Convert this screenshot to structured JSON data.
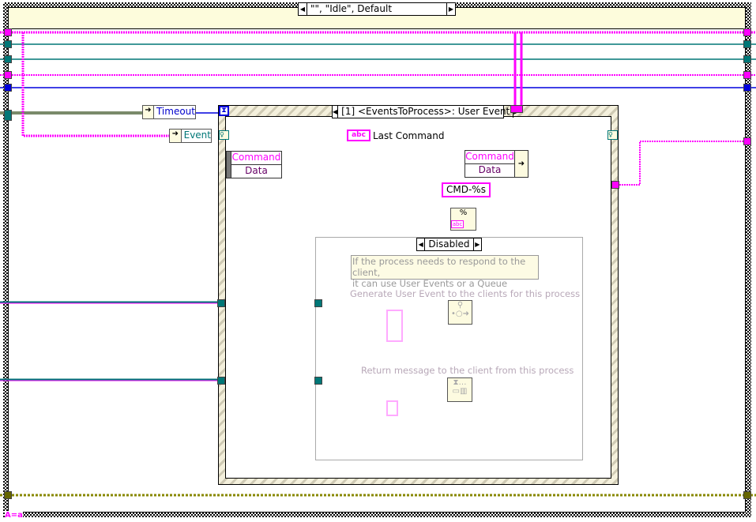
{
  "case_structure": {
    "selector": "\"\", \"Idle\", Default"
  },
  "event_structure": {
    "selector": "[1] <EventsToProcess>: User Event",
    "timeout_label": "Timeout",
    "event_label": "Event"
  },
  "unbundle": {
    "fields": [
      "Command",
      "Data"
    ]
  },
  "bundle": {
    "fields": [
      "Command",
      "Data"
    ]
  },
  "indicator": {
    "label": "Last Command",
    "type": "abc"
  },
  "format_constant": {
    "value": "CMD-%s"
  },
  "format_node": {
    "glyph": "%"
  },
  "diagram_disable": {
    "selector": "Disabled",
    "comment": [
      "If the process needs to respond to the client,",
      "it can use User Events or a Queue"
    ],
    "label_user_event": "Generate User Event to the clients for this process",
    "label_return_msg": "Return message to the client from this process"
  },
  "error_case_label": "A=a",
  "colors": {
    "string_wire": "#ff00ff",
    "refnum_wire": "#007777",
    "int_wire": "#0000dd",
    "cluster_wire": "#99aa88",
    "error_wire": "#888800",
    "structure_bg": "#fdfcdc"
  }
}
